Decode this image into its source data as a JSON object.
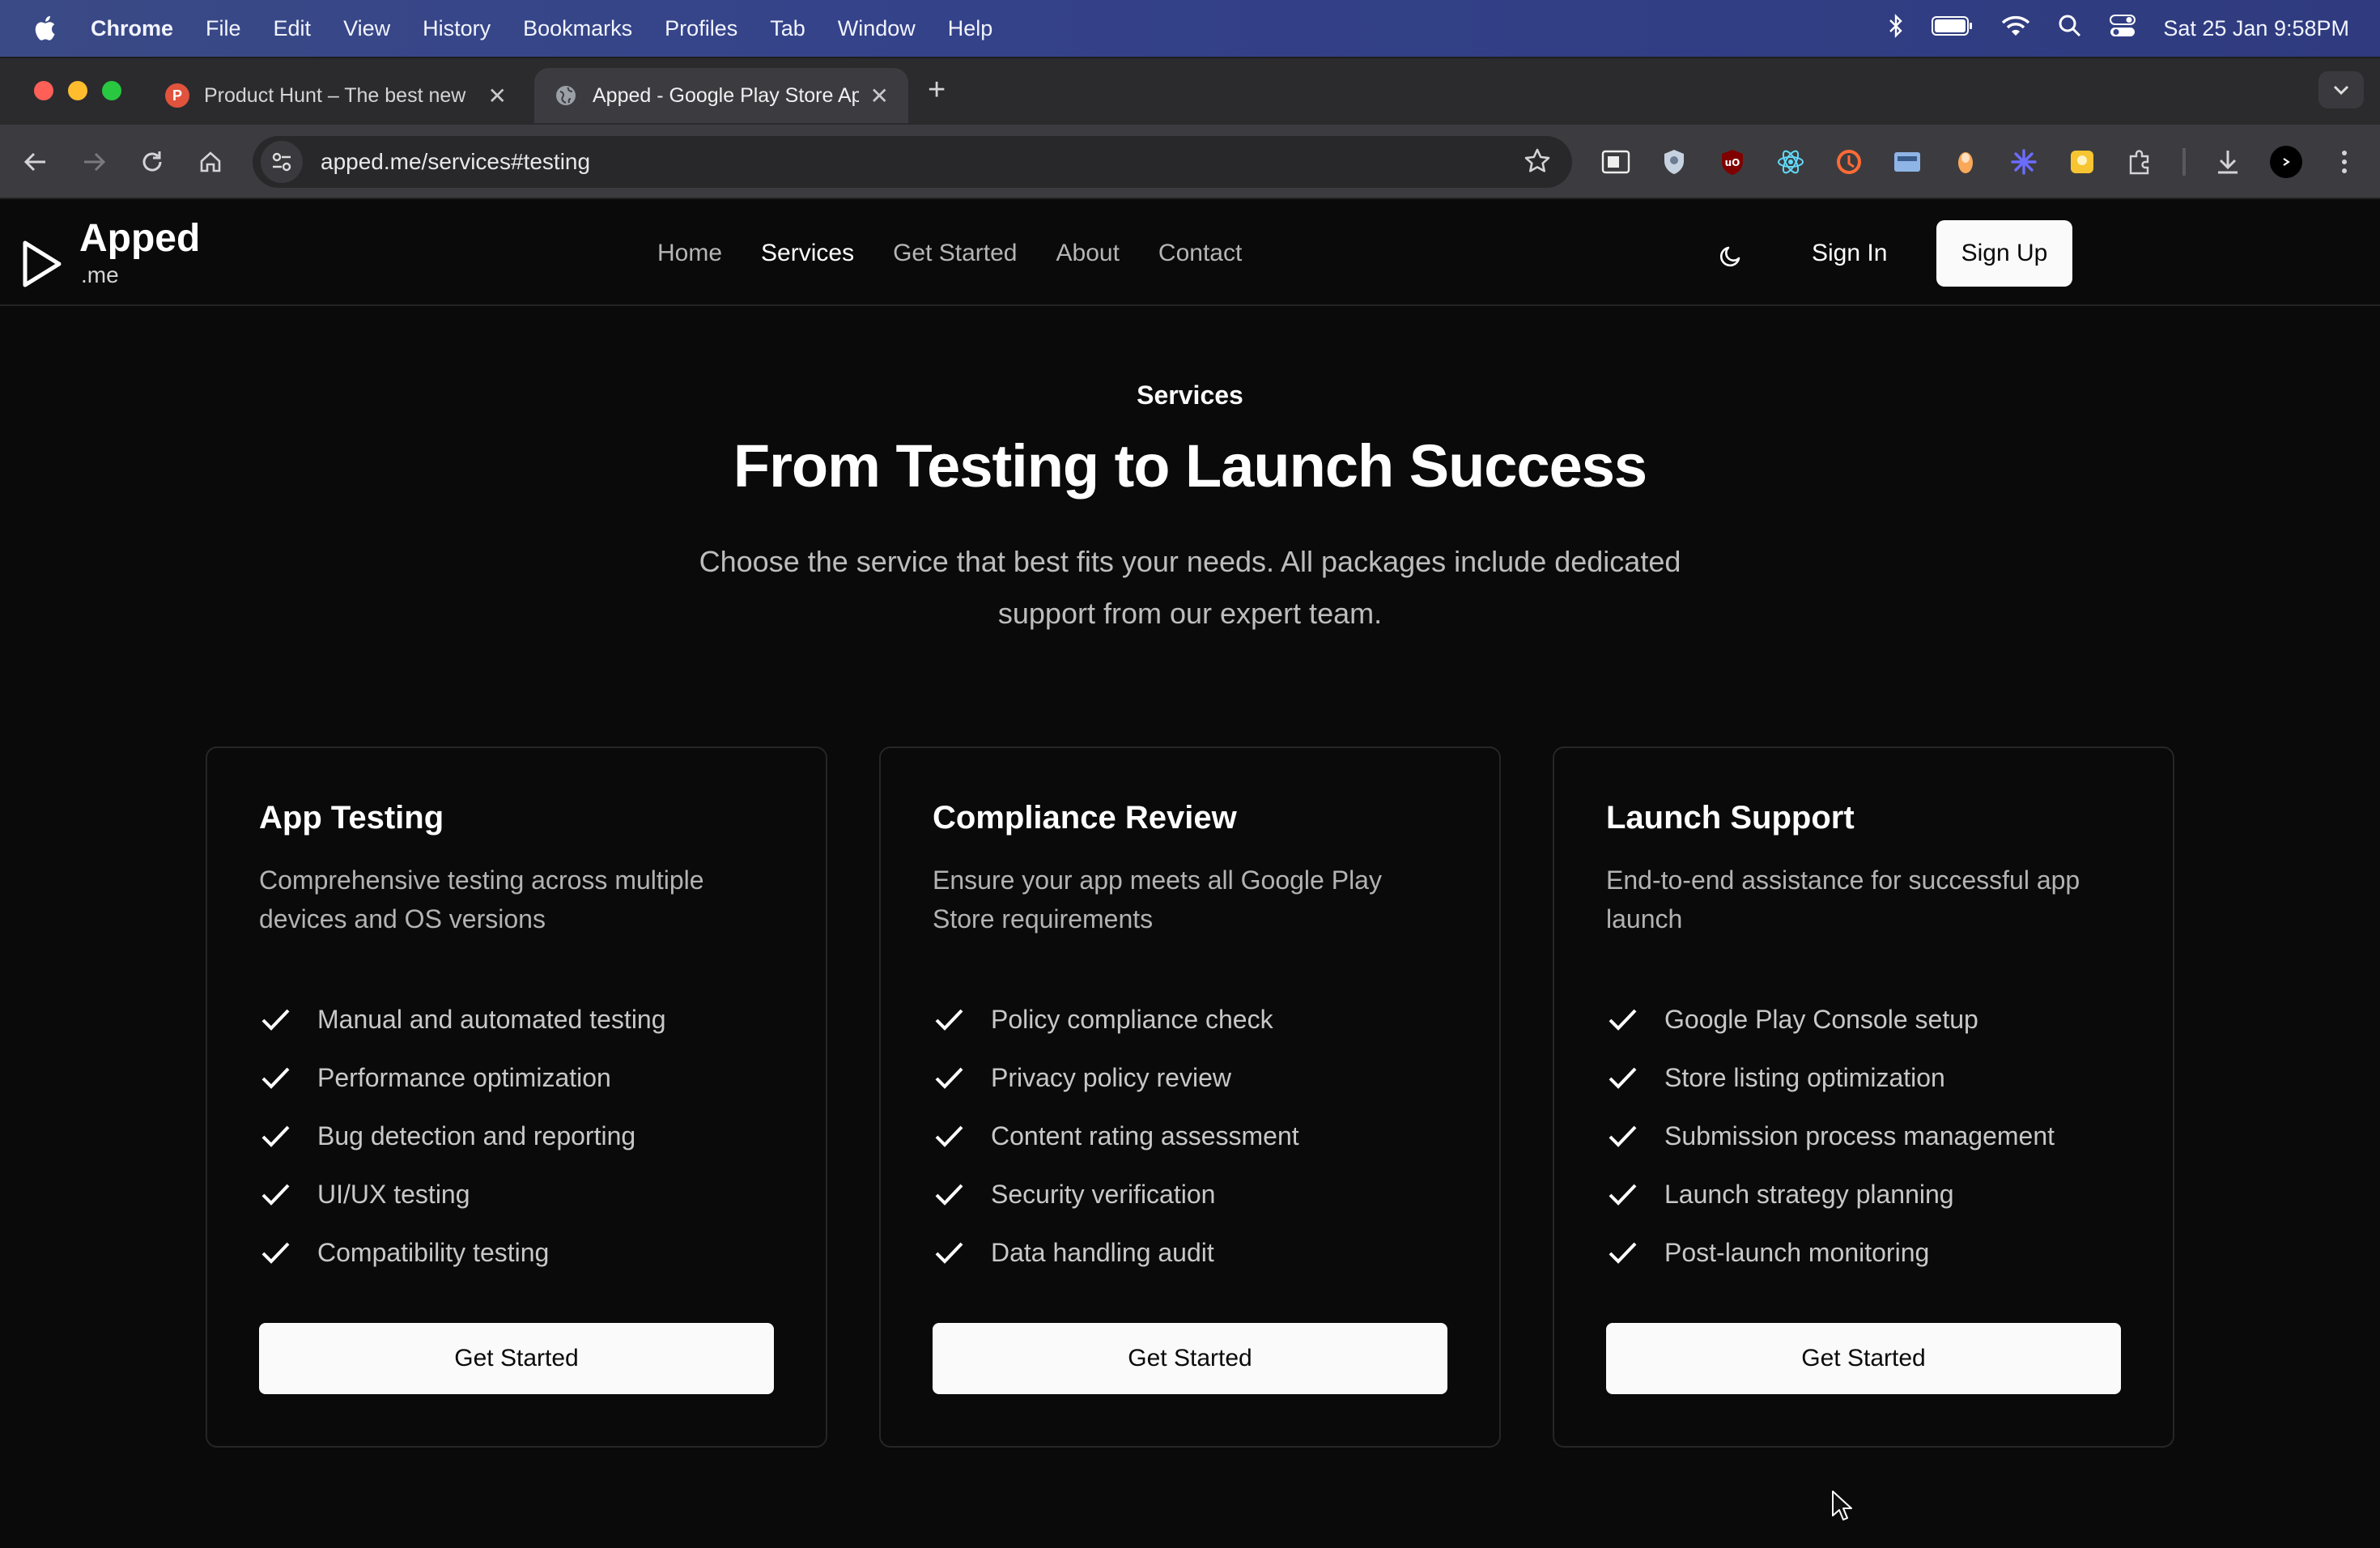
{
  "menubar": {
    "app_name": "Chrome",
    "items": [
      "File",
      "Edit",
      "View",
      "History",
      "Bookmarks",
      "Profiles",
      "Tab",
      "Window",
      "Help"
    ],
    "clock": "Sat 25 Jan  9:58PM"
  },
  "browser": {
    "tabs": [
      {
        "title": "Product Hunt – The best new",
        "favicon": "P"
      },
      {
        "title": "Apped - Google Play Store Ap",
        "favicon": "globe-icon"
      }
    ],
    "url": "apped.me/services#testing"
  },
  "site": {
    "brand_name": "Apped",
    "brand_sub": ".me",
    "nav": [
      "Home",
      "Services",
      "Get Started",
      "About",
      "Contact"
    ],
    "sign_in": "Sign In",
    "sign_up": "Sign Up"
  },
  "hero": {
    "eyebrow": "Services",
    "title": "From Testing to Launch Success",
    "description": "Choose the service that best fits your needs. All packages include dedicated support from our expert team."
  },
  "cards": [
    {
      "title": "App Testing",
      "description": "Comprehensive testing across multiple devices and OS versions",
      "features": [
        "Manual and automated testing",
        "Performance optimization",
        "Bug detection and reporting",
        "UI/UX testing",
        "Compatibility testing"
      ],
      "cta": "Get Started"
    },
    {
      "title": "Compliance Review",
      "description": "Ensure your app meets all Google Play Store requirements",
      "features": [
        "Policy compliance check",
        "Privacy policy review",
        "Content rating assessment",
        "Security verification",
        "Data handling audit"
      ],
      "cta": "Get Started"
    },
    {
      "title": "Launch Support",
      "description": "End-to-end assistance for successful app launch",
      "features": [
        "Google Play Console setup",
        "Store listing optimization",
        "Submission process management",
        "Launch strategy planning",
        "Post-launch monitoring"
      ],
      "cta": "Get Started"
    }
  ],
  "colors": {
    "background": "#0a0a0a",
    "card_border": "#262626",
    "button_bg": "#fafafa",
    "muted_text": "#b3b3b3"
  }
}
